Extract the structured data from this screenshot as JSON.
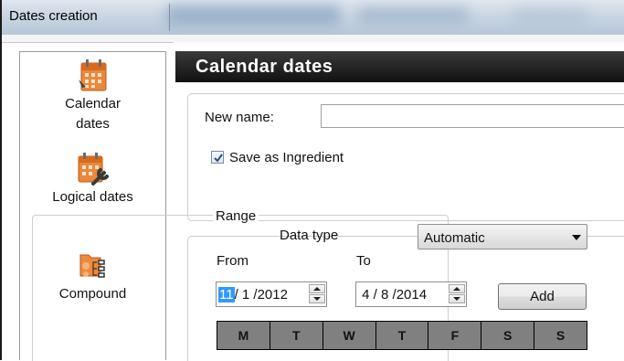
{
  "window": {
    "title": "Dates creation"
  },
  "sidebar": {
    "items": [
      {
        "label_line1": "Calendar",
        "label_line2": "dates",
        "icon": "calendar-icon"
      },
      {
        "label": "Logical dates",
        "icon": "calendar-wrench-icon"
      },
      {
        "label": "Compound",
        "icon": "compound-folder-icon"
      }
    ]
  },
  "header": {
    "title": "Calendar dates"
  },
  "form": {
    "new_name_label": "New name:",
    "new_name_value": "",
    "save_ingredient_label": "Save as Ingredient",
    "save_ingredient_checked": true
  },
  "range": {
    "group_label": "Range",
    "data_type_label": "Data type",
    "data_type_value": "Automatic",
    "from_label": "From",
    "to_label": "To",
    "from_selected": "11",
    "from_rest": "/ 1 /2012",
    "to_value": " 4 / 8 /2014",
    "add_label": "Add",
    "weekdays": [
      "M",
      "T",
      "W",
      "T",
      "F",
      "S",
      "S"
    ]
  },
  "colors": {
    "header_bg": "#1a1a1a",
    "selection": "#3399ff",
    "calendar_header": "#808080"
  }
}
